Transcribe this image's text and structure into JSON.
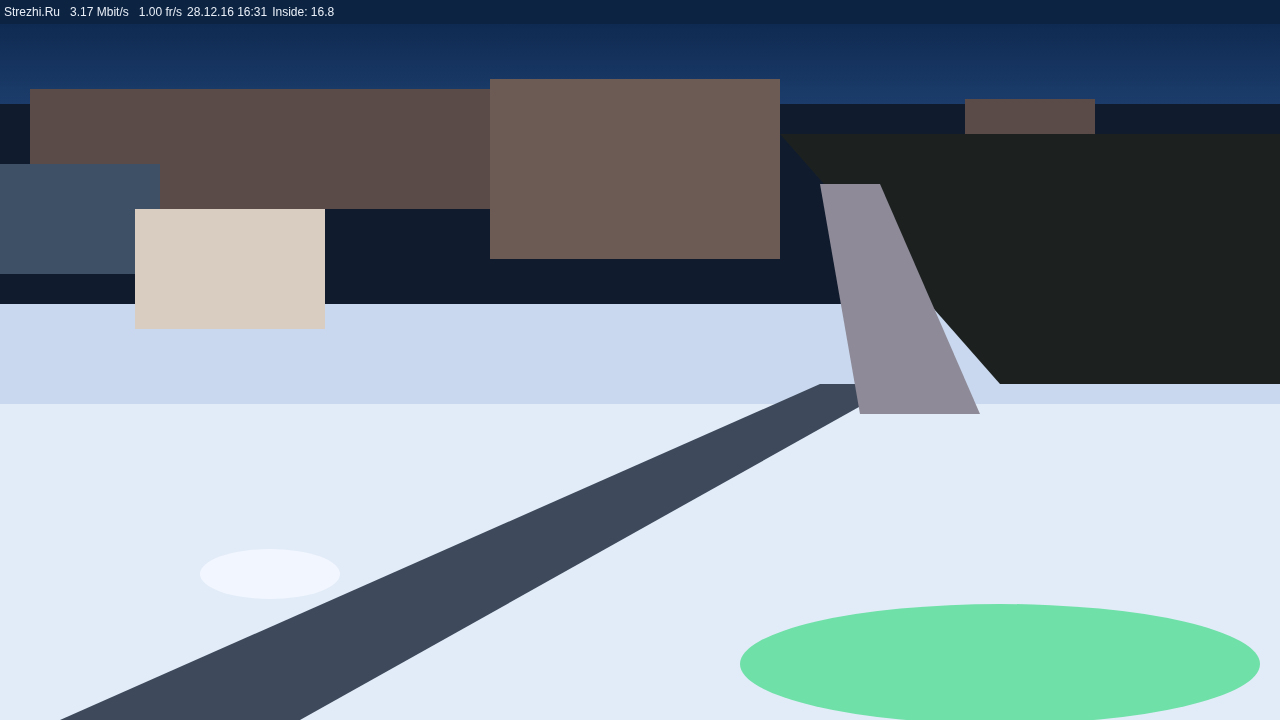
{
  "status_bar": {
    "site": "Strezhi.Ru",
    "bitrate": "3.17 Mbit/s",
    "frame_rate": "1.00 fr/s",
    "datetime": "28.12.16 16:31",
    "inside_temperature": "Inside: 16.8"
  }
}
